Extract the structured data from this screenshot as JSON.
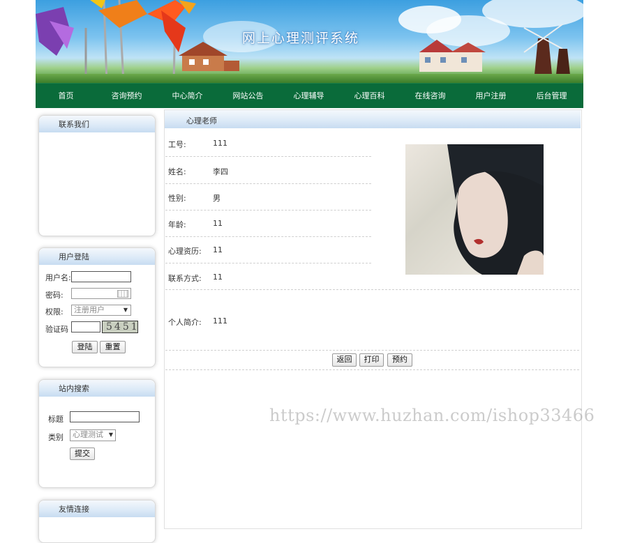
{
  "banner": {
    "title": "网上心理测评系统"
  },
  "nav": {
    "items": [
      "首页",
      "咨询预约",
      "中心简介",
      "网站公告",
      "心理辅导",
      "心理百科",
      "在线咨询",
      "用户注册",
      "后台管理"
    ]
  },
  "sidebar": {
    "contact": {
      "title": "联系我们"
    },
    "login": {
      "title": "用户登陆",
      "username_label": "用户名:",
      "password_label": "密码:",
      "role_label": "权限:",
      "role_value": "注册用户",
      "captcha_label": "验证码",
      "captcha_text": "5451",
      "login_button": "登陆",
      "reset_button": "重置"
    },
    "search": {
      "title": "站内搜索",
      "title_label": "标题",
      "category_label": "类别",
      "category_value": "心理测试",
      "submit_button": "提交"
    },
    "links": {
      "title": "友情连接"
    }
  },
  "main": {
    "title": "心理老师",
    "fields": [
      {
        "label": "工号:",
        "value": "111"
      },
      {
        "label": "姓名:",
        "value": "李四"
      },
      {
        "label": "性别:",
        "value": "男"
      },
      {
        "label": "年龄:",
        "value": "11"
      },
      {
        "label": "心理资历:",
        "value": "11"
      },
      {
        "label": "联系方式:",
        "value": "11"
      }
    ],
    "bio": {
      "label": "个人简介:",
      "value": "111"
    },
    "buttons": {
      "back": "返回",
      "print": "打印",
      "book": "预约"
    }
  },
  "watermark": "https://www.huzhan.com/ishop33466"
}
